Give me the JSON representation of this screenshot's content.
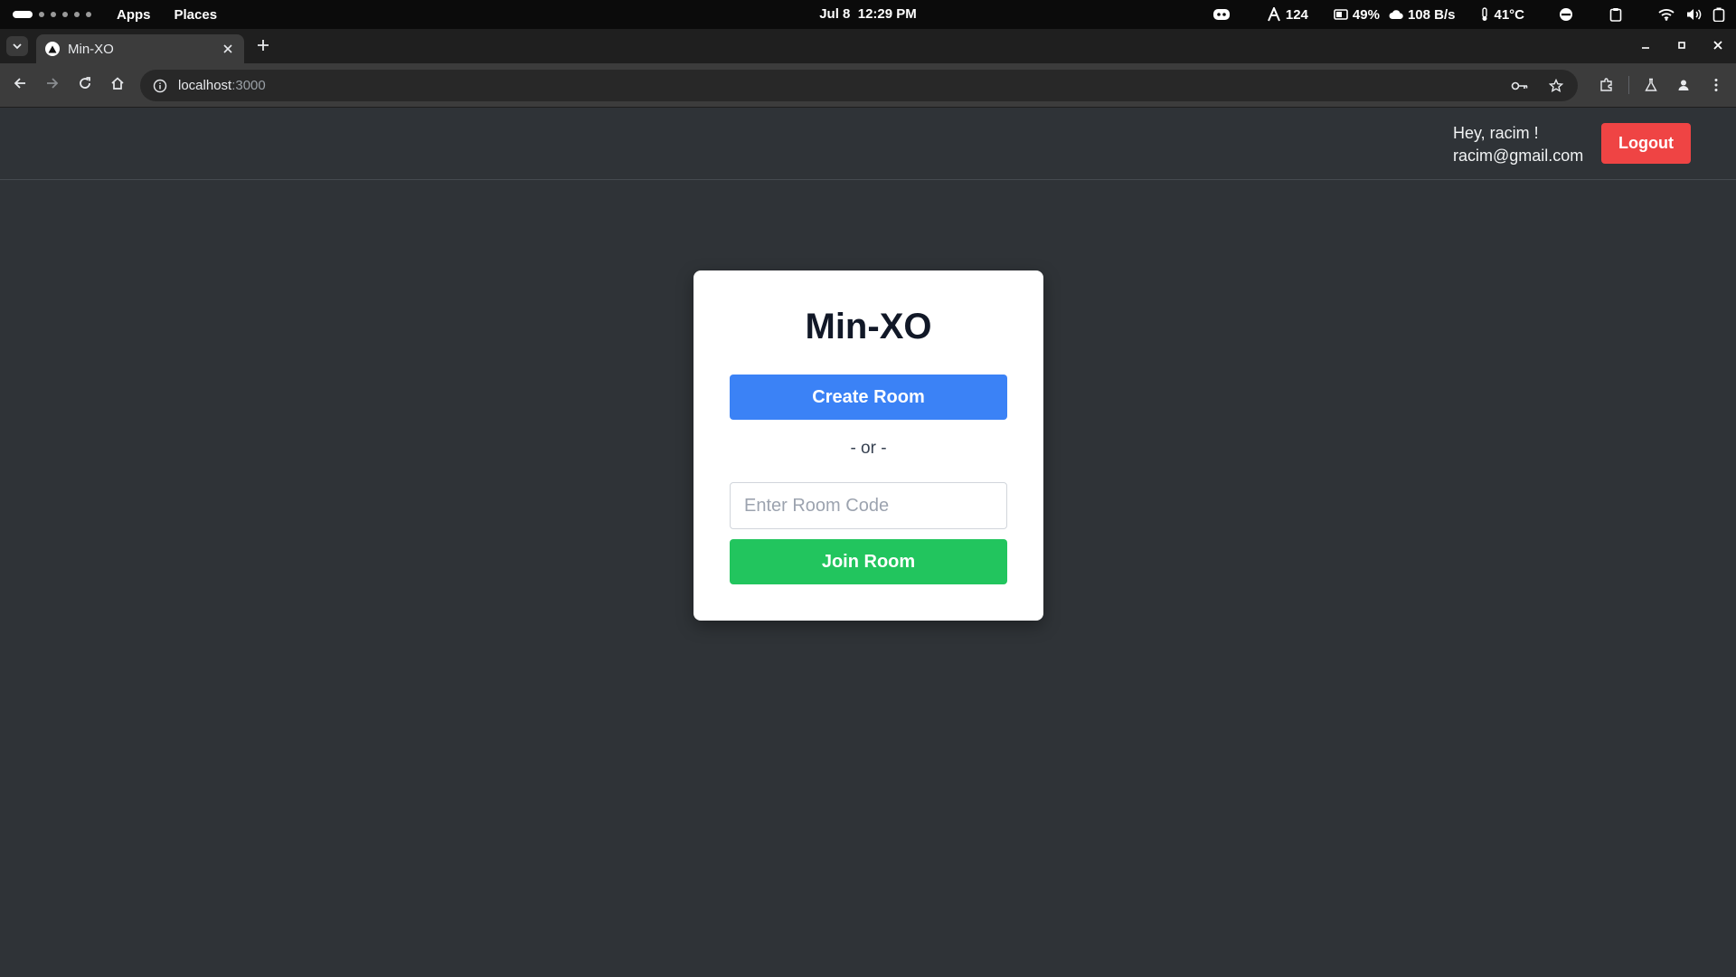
{
  "topbar": {
    "menu": [
      "Apps",
      "Places"
    ],
    "date": "Jul 8",
    "time": "12:29 PM",
    "tray": {
      "cpu_value": "124",
      "battery_value": "49%",
      "network_value": "108 B/s",
      "temperature_value": "41°C"
    }
  },
  "browser": {
    "tab_title": "Min-XO",
    "url_host": "localhost",
    "url_port": ":3000"
  },
  "app": {
    "greeting": "Hey, racim !",
    "email": "racim@gmail.com",
    "logout_label": "Logout",
    "title": "Min-XO",
    "create_label": "Create Room",
    "or_label": "- or -",
    "room_code_placeholder": "Enter Room Code",
    "room_code_value": "",
    "join_label": "Join Room"
  },
  "colors": {
    "page_background": "#2f3337",
    "create_button": "#3b82f6",
    "join_button": "#22c55e",
    "logout_button": "#ef4444"
  }
}
